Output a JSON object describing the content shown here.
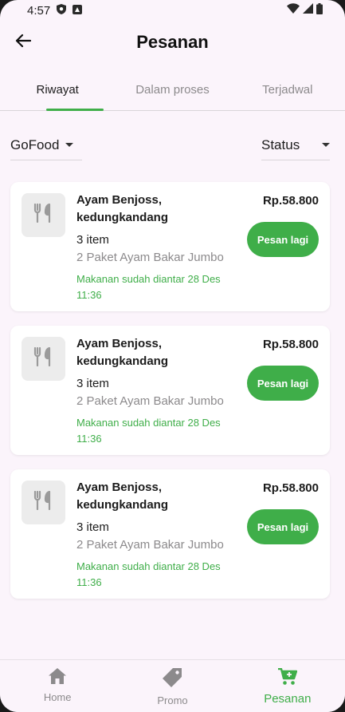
{
  "status_bar": {
    "time": "4:57"
  },
  "header": {
    "title": "Pesanan"
  },
  "tabs": [
    {
      "label": "Riwayat",
      "active": true
    },
    {
      "label": "Dalam proses",
      "active": false
    },
    {
      "label": "Terjadwal",
      "active": false
    }
  ],
  "filters": {
    "service": "GoFood",
    "status": "Status"
  },
  "orders": [
    {
      "restaurant": "Ayam Benjoss, kedungkandang",
      "price": "Rp.58.800",
      "items_count": "3 item",
      "items_desc": "2 Paket Ayam Bakar Jumbo",
      "status": "Makanan sudah diantar 28 Des 11:36",
      "reorder_label": "Pesan lagi"
    },
    {
      "restaurant": "Ayam Benjoss, kedungkandang",
      "price": "Rp.58.800",
      "items_count": "3 item",
      "items_desc": "2 Paket Ayam Bakar Jumbo",
      "status": "Makanan sudah diantar 28 Des 11:36",
      "reorder_label": "Pesan lagi"
    },
    {
      "restaurant": "Ayam Benjoss, kedungkandang",
      "price": "Rp.58.800",
      "items_count": "3 item",
      "items_desc": "2 Paket Ayam Bakar Jumbo",
      "status": "Makanan sudah diantar 28 Des 11:36",
      "reorder_label": "Pesan lagi"
    }
  ],
  "bottom_nav": [
    {
      "label": "Home",
      "icon": "home-icon",
      "active": false
    },
    {
      "label": "Promo",
      "icon": "tag-icon",
      "active": false
    },
    {
      "label": "Pesanan",
      "icon": "cart-icon",
      "active": true
    }
  ],
  "colors": {
    "accent": "#3fae49",
    "background": "#fbf4fb",
    "card": "#ffffff"
  }
}
